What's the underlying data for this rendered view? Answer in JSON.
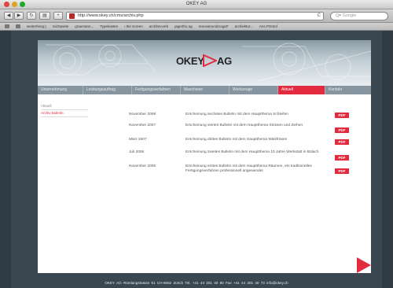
{
  "window": {
    "title": "OKEY AG"
  },
  "toolbar": {
    "url": "http://www.okey.ch/cms/archiv.php",
    "reload": "C",
    "search_placeholder": "Google"
  },
  "bookmarks": [
    "weiterhring:)",
    "Sichtweite",
    "graumann...",
    "Typekasten",
    "i the screen",
    "architecverb",
    "jagertho ag",
    "renovierunsbrogat*",
    "archiektur...",
    "Ans.PGrünl"
  ],
  "brand": {
    "okey": "OKEY",
    "ag": "AG"
  },
  "nav": [
    {
      "label": "Unternehmung",
      "active": false
    },
    {
      "label": "Leistungsauftrag",
      "active": false
    },
    {
      "label": "Fertigungsverfahren",
      "active": false
    },
    {
      "label": "Maschinen",
      "active": false
    },
    {
      "label": "Werkzeuge",
      "active": false
    },
    {
      "label": "Aktuell",
      "active": true
    },
    {
      "label": "Kontakt",
      "active": false
    }
  ],
  "subnav": [
    {
      "label": "Aktuell",
      "active": false
    },
    {
      "label": "Archiv Bulletin",
      "active": true
    }
  ],
  "archive": [
    {
      "date": "November 2008",
      "text": "Erscheinung sechstes Bulletin mit dem Hauptthema Schleifen",
      "pdf": "PDF"
    },
    {
      "date": "November 2007",
      "text": "Erscheinung viertes Bulletin mit dem Hauptthema Stossen und Ziehen",
      "pdf": "PDF"
    },
    {
      "date": "März 2007",
      "text": "Erscheinung drittes Bulletin mit dem Hauptthema Wälzfräsen",
      "pdf": "PDF"
    },
    {
      "date": "Juli 2006",
      "text": "Erscheinung zweites Bulletin mit dem Hauptthema 10 Jahre Werkstatt in Bülach",
      "pdf": "PDF"
    },
    {
      "date": "November 2005",
      "text": "Erscheinung erstes Bulletin mit dem Hauptthema Räumen, ein traditionelles Fertigungsverfahren professionell angewendet",
      "pdf": "PDF"
    }
  ],
  "footer": "OKEY AG  Rümlangstrasse 91  CH-8052 Zürich  Tel. +41 44 301 40 80  Fax +41 44 301 40 73  info@okey.ch",
  "colors": {
    "accent": "#e22b3f",
    "nav": "#8795a0",
    "background": "#3b4750"
  }
}
